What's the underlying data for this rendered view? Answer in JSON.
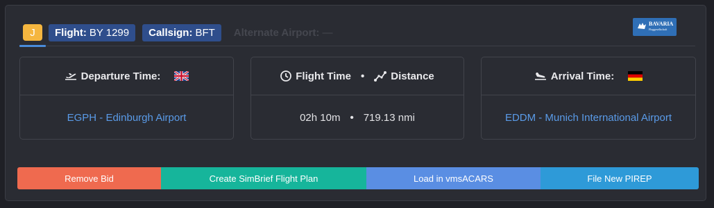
{
  "header": {
    "class_code": "J",
    "flight_label": "Flight:",
    "flight_value": "BY 1299",
    "callsign_label": "Callsign:",
    "callsign_value": "BFT",
    "alternate_label": "Alternate Airport:",
    "alternate_value": "—",
    "airline_logo_text": "BAVARIA",
    "airline_logo_subtext": "Fluggesellschaft"
  },
  "departure": {
    "title": "Departure Time:",
    "flag": "united-kingdom-flag",
    "airport": "EGPH - Edinburgh Airport"
  },
  "middle": {
    "flight_time_label": "Flight Time",
    "distance_label": "Distance",
    "flight_time_value": "02h 10m",
    "distance_value": "719.13 nmi",
    "separator": "•"
  },
  "arrival": {
    "title": "Arrival Time:",
    "flag": "germany-flag",
    "airport": "EDDM - Munich International Airport"
  },
  "actions": {
    "remove_bid": "Remove Bid",
    "simbrief": "Create SimBrief Flight Plan",
    "vmsacars": "Load in vmsACARS",
    "pirep": "File New PIREP"
  },
  "colors": {
    "class_badge": "#f5b63f",
    "pill": "#2f4e8c",
    "link": "#5a9be8",
    "remove_bid": "#ef6a4f",
    "simbrief": "#16b59b",
    "vmsacars": "#5a8ee3",
    "pirep": "#2e9ad8"
  }
}
